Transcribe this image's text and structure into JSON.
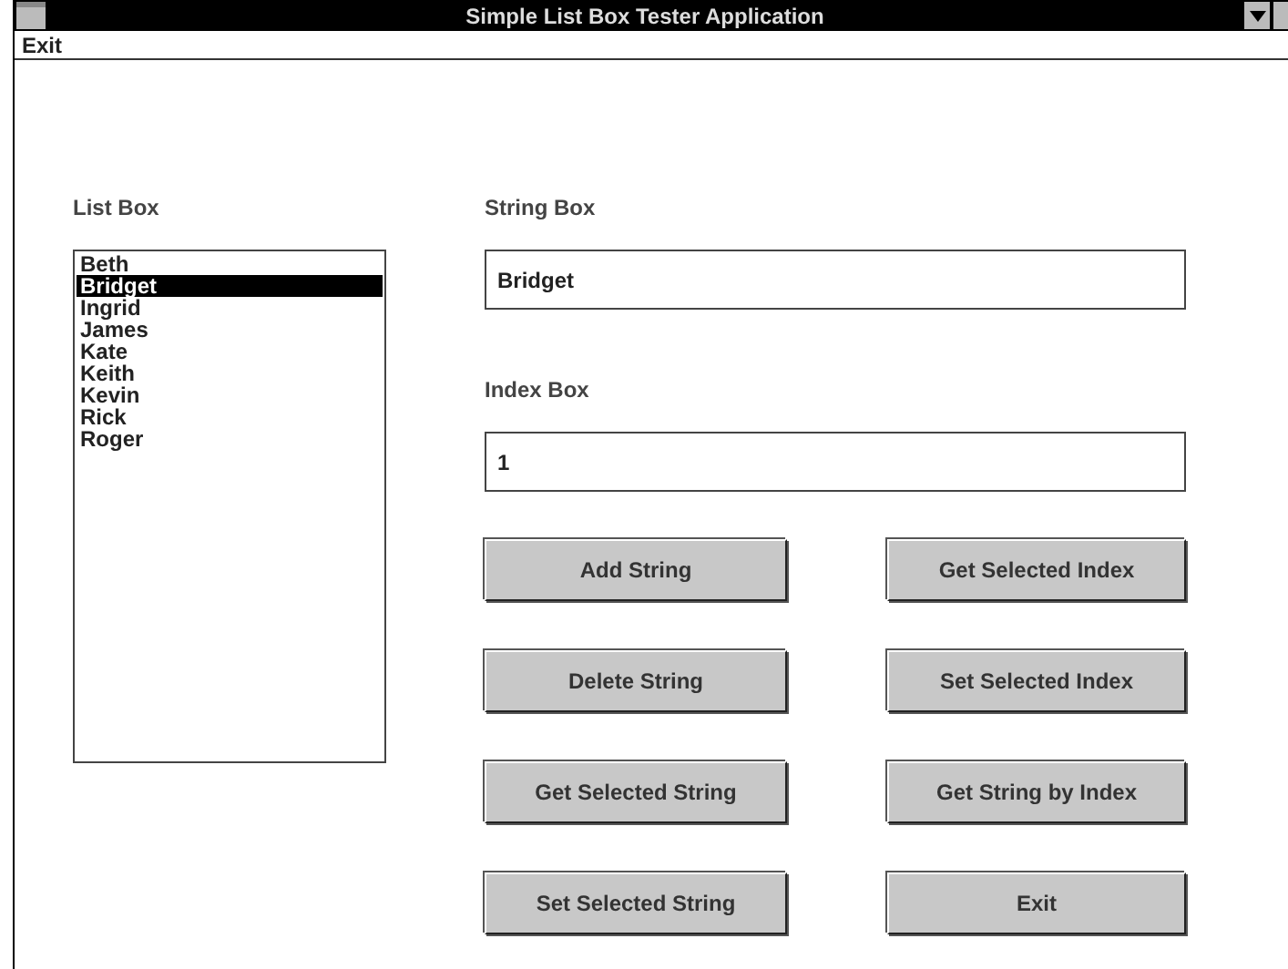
{
  "window": {
    "title": "Simple List Box Tester Application"
  },
  "menu": [
    {
      "label": "Exit"
    }
  ],
  "list_box": {
    "label": "List Box",
    "items": [
      {
        "label": "Beth",
        "selected": false
      },
      {
        "label": "Bridget",
        "selected": true
      },
      {
        "label": "Ingrid",
        "selected": false
      },
      {
        "label": "James",
        "selected": false
      },
      {
        "label": "Kate",
        "selected": false
      },
      {
        "label": "Keith",
        "selected": false
      },
      {
        "label": "Kevin",
        "selected": false
      },
      {
        "label": "Rick",
        "selected": false
      },
      {
        "label": "Roger",
        "selected": false
      }
    ]
  },
  "string_box": {
    "label": "String Box",
    "value": "Bridget"
  },
  "index_box": {
    "label": "Index Box",
    "value": "1"
  },
  "buttons": [
    "Add String",
    "Get Selected Index",
    "Delete String",
    "Set Selected Index",
    "Get Selected String",
    "Get String by Index",
    "Set Selected String",
    "Exit"
  ]
}
